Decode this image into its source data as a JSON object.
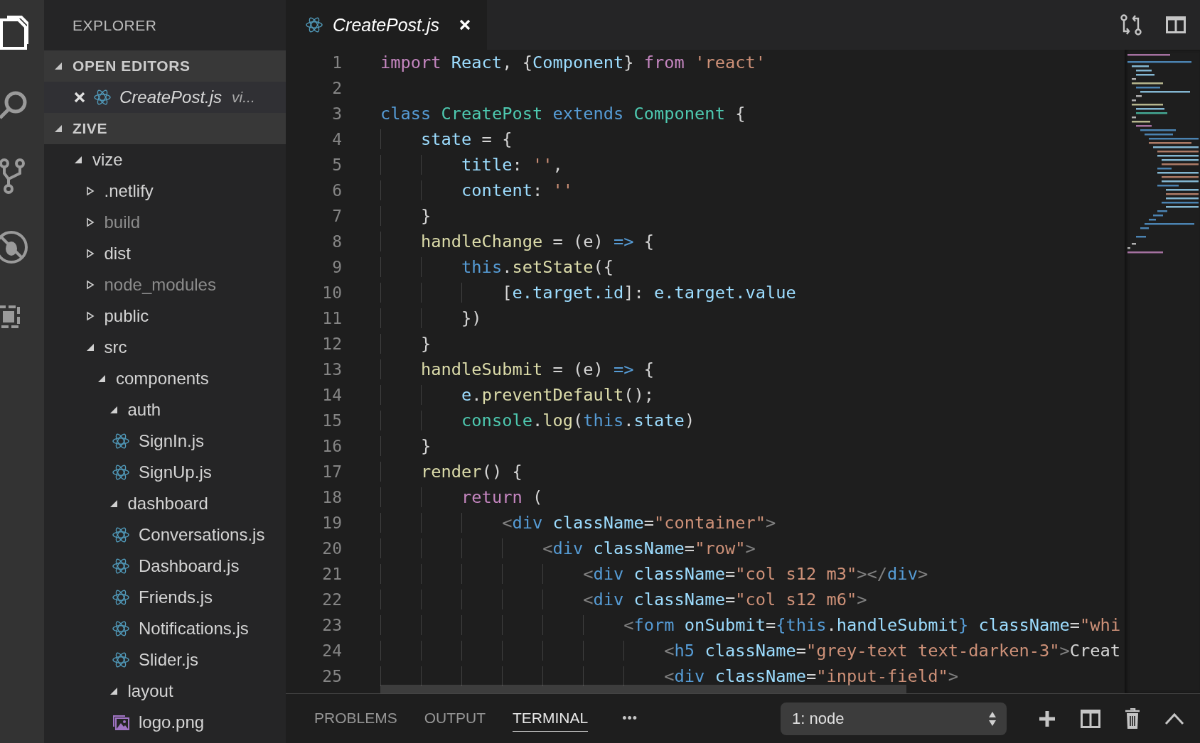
{
  "activity_bar": {
    "items": [
      {
        "kind": "files",
        "selected": true
      },
      {
        "kind": "search",
        "selected": false
      },
      {
        "kind": "source_control",
        "selected": false
      },
      {
        "kind": "debug",
        "selected": false
      },
      {
        "kind": "extensions",
        "selected": false
      }
    ]
  },
  "sidebar": {
    "title": "EXPLORER",
    "open_editors": {
      "title": "OPEN EDITORS",
      "expanded": true,
      "items": [
        {
          "name": "CreatePost.js",
          "description": "vi...",
          "kind": "react"
        }
      ]
    },
    "folder": {
      "title": "ZIVE",
      "expanded": true,
      "tree": [
        {
          "name": "vize",
          "kind": "folder",
          "expanded": true,
          "ignored": false,
          "children": [
            {
              "name": ".netlify",
              "kind": "folder",
              "expanded": false,
              "ignored": false
            },
            {
              "name": "build",
              "kind": "folder",
              "expanded": false,
              "ignored": true
            },
            {
              "name": "dist",
              "kind": "folder",
              "expanded": false,
              "ignored": false
            },
            {
              "name": "node_modules",
              "kind": "folder",
              "expanded": false,
              "ignored": true
            },
            {
              "name": "public",
              "kind": "folder",
              "expanded": false,
              "ignored": false
            },
            {
              "name": "src",
              "kind": "folder",
              "expanded": true,
              "ignored": false,
              "children": [
                {
                  "name": "components",
                  "kind": "folder",
                  "expanded": true,
                  "ignored": false,
                  "children": [
                    {
                      "name": "auth",
                      "kind": "folder",
                      "expanded": true,
                      "ignored": false,
                      "children": [
                        {
                          "name": "SignIn.js",
                          "kind": "react",
                          "ignored": false
                        },
                        {
                          "name": "SignUp.js",
                          "kind": "react",
                          "ignored": false
                        }
                      ]
                    },
                    {
                      "name": "dashboard",
                      "kind": "folder",
                      "expanded": true,
                      "ignored": false,
                      "children": [
                        {
                          "name": "Conversations.js",
                          "kind": "react",
                          "ignored": false
                        },
                        {
                          "name": "Dashboard.js",
                          "kind": "react",
                          "ignored": false
                        },
                        {
                          "name": "Friends.js",
                          "kind": "react",
                          "ignored": false
                        },
                        {
                          "name": "Notifications.js",
                          "kind": "react",
                          "ignored": false
                        },
                        {
                          "name": "Slider.js",
                          "kind": "react",
                          "ignored": false
                        }
                      ]
                    },
                    {
                      "name": "layout",
                      "kind": "folder",
                      "expanded": true,
                      "ignored": false,
                      "children": [
                        {
                          "name": "logo.png",
                          "kind": "image",
                          "ignored": false
                        }
                      ]
                    }
                  ]
                }
              ]
            }
          ]
        }
      ]
    }
  },
  "editor": {
    "tabs": [
      {
        "label": "CreatePost.js",
        "kind": "react",
        "selected": true
      }
    ],
    "lines": [
      {
        "number": "1",
        "tokens": [
          {
            "kind": "keyword",
            "text": "import "
          },
          {
            "kind": "variable",
            "text": "React"
          },
          {
            "kind": "plain",
            "text": ", {"
          },
          {
            "kind": "variable",
            "text": "Component"
          },
          {
            "kind": "plain",
            "text": "} "
          },
          {
            "kind": "keyword",
            "text": "from "
          },
          {
            "kind": "string",
            "text": "'react'"
          }
        ]
      },
      {
        "number": "2"
      },
      {
        "number": "3",
        "tokens": [
          {
            "kind": "storage",
            "text": "class "
          },
          {
            "kind": "type",
            "text": "CreatePost "
          },
          {
            "kind": "storage",
            "text": "extends "
          },
          {
            "kind": "type",
            "text": "Component"
          },
          {
            "kind": "plain",
            "text": " {"
          }
        ]
      },
      {
        "number": "4",
        "tokens": [
          {
            "kind": "variable",
            "text": "    state"
          },
          {
            "kind": "plain",
            "text": " = {"
          }
        ]
      },
      {
        "number": "5",
        "tokens": [
          {
            "kind": "variable",
            "text": "        title"
          },
          {
            "kind": "plain",
            "text": ": "
          },
          {
            "kind": "string",
            "text": "''"
          },
          {
            "kind": "plain",
            "text": ","
          }
        ]
      },
      {
        "number": "6",
        "tokens": [
          {
            "kind": "variable",
            "text": "        content"
          },
          {
            "kind": "plain",
            "text": ": "
          },
          {
            "kind": "string",
            "text": "''"
          }
        ]
      },
      {
        "number": "7",
        "tokens": [
          {
            "kind": "plain",
            "text": "    }"
          }
        ]
      },
      {
        "number": "8",
        "tokens": [
          {
            "kind": "function",
            "text": "    handleChange"
          },
          {
            "kind": "plain",
            "text": " = (e) "
          },
          {
            "kind": "storage",
            "text": "=>"
          },
          {
            "kind": "plain",
            "text": " {"
          }
        ]
      },
      {
        "number": "9",
        "tokens": [
          {
            "kind": "storage",
            "text": "        this"
          },
          {
            "kind": "plain",
            "text": "."
          },
          {
            "kind": "function",
            "text": "setState"
          },
          {
            "kind": "plain",
            "text": "({"
          }
        ]
      },
      {
        "number": "10",
        "tokens": [
          {
            "kind": "plain",
            "text": "            ["
          },
          {
            "kind": "variable",
            "text": "e.target.id"
          },
          {
            "kind": "plain",
            "text": "]: "
          },
          {
            "kind": "variable",
            "text": "e.target.value"
          }
        ]
      },
      {
        "number": "11",
        "tokens": [
          {
            "kind": "plain",
            "text": "        })"
          }
        ]
      },
      {
        "number": "12",
        "tokens": [
          {
            "kind": "plain",
            "text": "    }"
          }
        ]
      },
      {
        "number": "13",
        "tokens": [
          {
            "kind": "function",
            "text": "    handleSubmit"
          },
          {
            "kind": "plain",
            "text": " = (e) "
          },
          {
            "kind": "storage",
            "text": "=>"
          },
          {
            "kind": "plain",
            "text": " {"
          }
        ]
      },
      {
        "number": "14",
        "tokens": [
          {
            "kind": "variable",
            "text": "        e"
          },
          {
            "kind": "plain",
            "text": "."
          },
          {
            "kind": "function",
            "text": "preventDefault"
          },
          {
            "kind": "plain",
            "text": "();"
          }
        ]
      },
      {
        "number": "15",
        "tokens": [
          {
            "kind": "type",
            "text": "        console"
          },
          {
            "kind": "plain",
            "text": "."
          },
          {
            "kind": "function",
            "text": "log"
          },
          {
            "kind": "plain",
            "text": "("
          },
          {
            "kind": "storage",
            "text": "this"
          },
          {
            "kind": "plain",
            "text": "."
          },
          {
            "kind": "variable",
            "text": "state"
          },
          {
            "kind": "plain",
            "text": ")"
          }
        ]
      },
      {
        "number": "16",
        "tokens": [
          {
            "kind": "plain",
            "text": "    }"
          }
        ]
      },
      {
        "number": "17",
        "tokens": [
          {
            "kind": "function",
            "text": "    render"
          },
          {
            "kind": "plain",
            "text": "() {"
          }
        ]
      },
      {
        "number": "18",
        "tokens": [
          {
            "kind": "keyword",
            "text": "        return"
          },
          {
            "kind": "plain",
            "text": " ("
          }
        ]
      },
      {
        "number": "19",
        "tokens": [
          {
            "kind": "punct",
            "text": "            <"
          },
          {
            "kind": "tag",
            "text": "div "
          },
          {
            "kind": "attr",
            "text": "className"
          },
          {
            "kind": "plain",
            "text": "="
          },
          {
            "kind": "string",
            "text": "\"container\""
          },
          {
            "kind": "punct",
            "text": ">"
          }
        ]
      },
      {
        "number": "20",
        "tokens": [
          {
            "kind": "punct",
            "text": "                <"
          },
          {
            "kind": "tag",
            "text": "div "
          },
          {
            "kind": "attr",
            "text": "className"
          },
          {
            "kind": "plain",
            "text": "="
          },
          {
            "kind": "string",
            "text": "\"row\""
          },
          {
            "kind": "punct",
            "text": ">"
          }
        ]
      },
      {
        "number": "21",
        "tokens": [
          {
            "kind": "punct",
            "text": "                    <"
          },
          {
            "kind": "tag",
            "text": "div "
          },
          {
            "kind": "attr",
            "text": "className"
          },
          {
            "kind": "plain",
            "text": "="
          },
          {
            "kind": "string",
            "text": "\"col s12 m3\""
          },
          {
            "kind": "punct",
            "text": "></"
          },
          {
            "kind": "tag",
            "text": "div"
          },
          {
            "kind": "punct",
            "text": ">"
          }
        ]
      },
      {
        "number": "22",
        "tokens": [
          {
            "kind": "punct",
            "text": "                    <"
          },
          {
            "kind": "tag",
            "text": "div "
          },
          {
            "kind": "attr",
            "text": "className"
          },
          {
            "kind": "plain",
            "text": "="
          },
          {
            "kind": "string",
            "text": "\"col s12 m6\""
          },
          {
            "kind": "punct",
            "text": ">"
          }
        ]
      },
      {
        "number": "23",
        "tokens": [
          {
            "kind": "punct",
            "text": "                        <"
          },
          {
            "kind": "tag",
            "text": "form "
          },
          {
            "kind": "attr",
            "text": "onSubmit"
          },
          {
            "kind": "plain",
            "text": "="
          },
          {
            "kind": "storage",
            "text": "{this"
          },
          {
            "kind": "plain",
            "text": "."
          },
          {
            "kind": "variable",
            "text": "handleSubmit"
          },
          {
            "kind": "storage",
            "text": "} "
          },
          {
            "kind": "attr",
            "text": "className"
          },
          {
            "kind": "plain",
            "text": "="
          },
          {
            "kind": "string",
            "text": "\"whi"
          }
        ]
      },
      {
        "number": "24",
        "tokens": [
          {
            "kind": "punct",
            "text": "                            <"
          },
          {
            "kind": "tag",
            "text": "h5 "
          },
          {
            "kind": "attr",
            "text": "className"
          },
          {
            "kind": "plain",
            "text": "="
          },
          {
            "kind": "string",
            "text": "\"grey-text text-darken-3\""
          },
          {
            "kind": "punct",
            "text": ">"
          },
          {
            "kind": "plain",
            "text": "Creat"
          }
        ]
      },
      {
        "number": "25",
        "tokens": [
          {
            "kind": "punct",
            "text": "                            <"
          },
          {
            "kind": "tag",
            "text": "div "
          },
          {
            "kind": "attr",
            "text": "className"
          },
          {
            "kind": "plain",
            "text": "="
          },
          {
            "kind": "string",
            "text": "\"input-field\""
          },
          {
            "kind": "punct",
            "text": ">"
          }
        ]
      }
    ]
  },
  "panel": {
    "tabs": [
      {
        "label": "PROBLEMS",
        "selected": false
      },
      {
        "label": "OUTPUT",
        "selected": false
      },
      {
        "label": "TERMINAL",
        "selected": true
      }
    ],
    "more": "•••",
    "terminal_select": {
      "value": "1: node"
    }
  }
}
